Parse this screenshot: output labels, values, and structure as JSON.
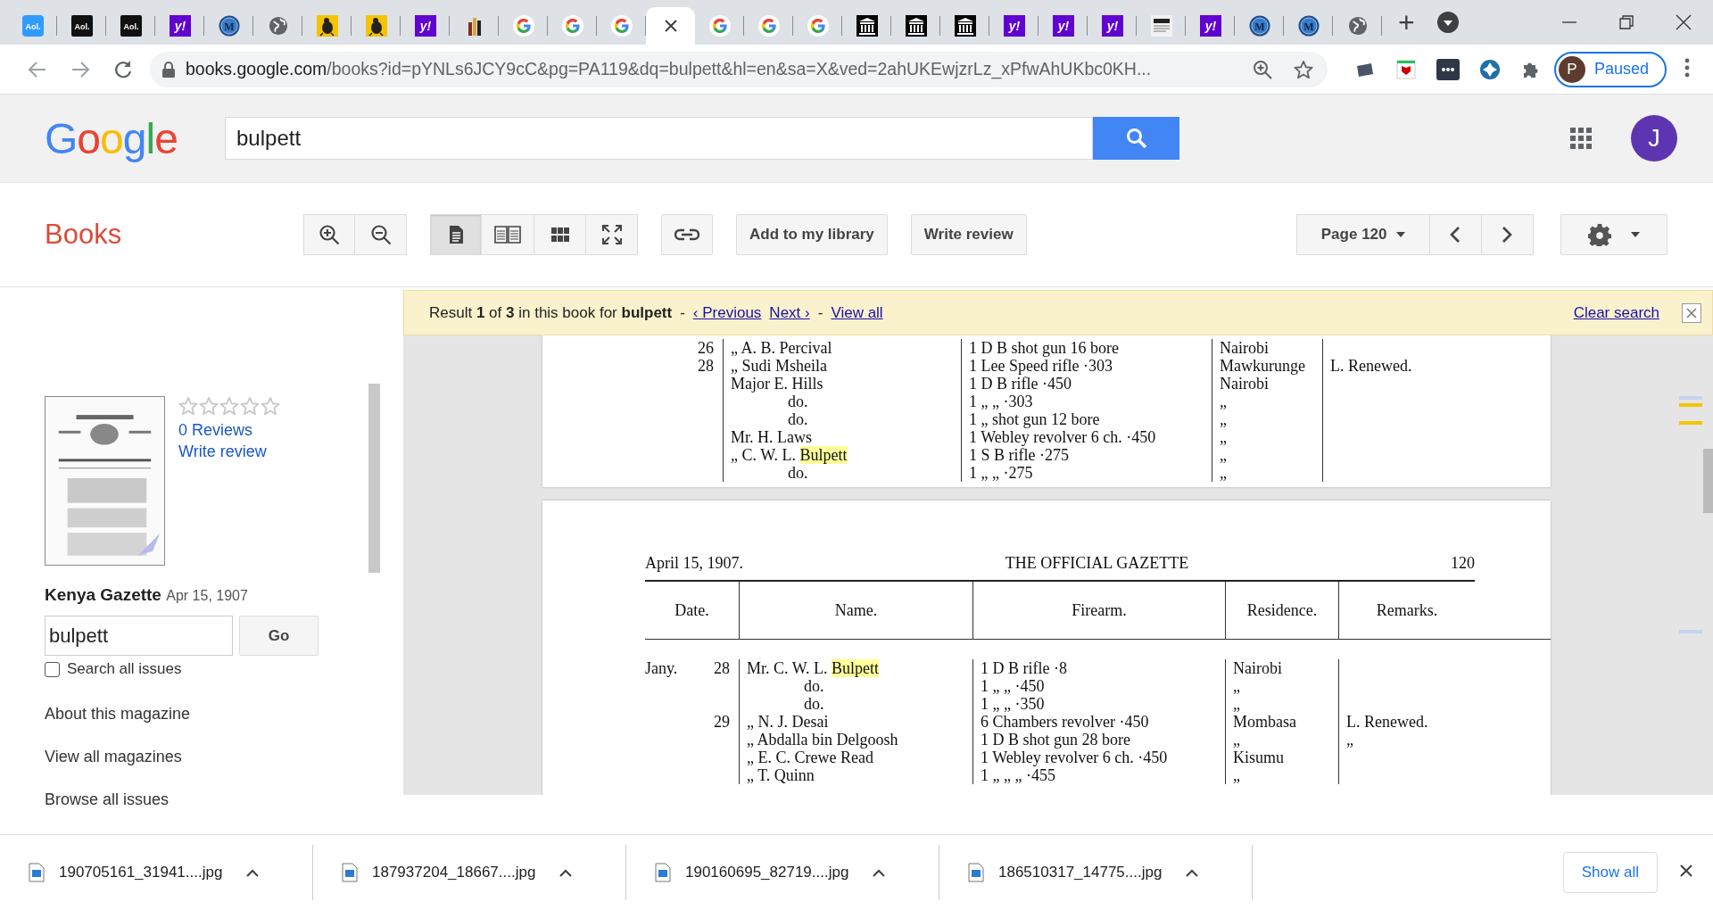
{
  "browser": {
    "tabs": [
      {
        "kind": "aol-blue",
        "text": "Aol.",
        "selected": false
      },
      {
        "kind": "aol-black",
        "text": "Aol.",
        "selected": false
      },
      {
        "kind": "aol-black",
        "text": "Aol.",
        "selected": false
      },
      {
        "kind": "yahoo",
        "text": "y!",
        "selected": false
      },
      {
        "kind": "m",
        "text": "M",
        "selected": false
      },
      {
        "kind": "globe",
        "selected": false
      },
      {
        "kind": "bird",
        "selected": false
      },
      {
        "kind": "bird",
        "selected": false
      },
      {
        "kind": "yahoo",
        "text": "y!",
        "selected": false
      },
      {
        "kind": "tower",
        "selected": false
      },
      {
        "kind": "google",
        "selected": false
      },
      {
        "kind": "google",
        "selected": false
      },
      {
        "kind": "google",
        "selected": false
      },
      {
        "kind": "none",
        "selected": true
      },
      {
        "kind": "google",
        "selected": false
      },
      {
        "kind": "google",
        "selected": false
      },
      {
        "kind": "google",
        "selected": false
      },
      {
        "kind": "columns",
        "selected": false
      },
      {
        "kind": "columns",
        "selected": false
      },
      {
        "kind": "columns",
        "selected": false
      },
      {
        "kind": "yahoo",
        "text": "y!",
        "selected": false
      },
      {
        "kind": "yahoo",
        "text": "y!",
        "selected": false
      },
      {
        "kind": "yahoo",
        "text": "y!",
        "selected": false
      },
      {
        "kind": "newspaper",
        "selected": false
      },
      {
        "kind": "yahoo",
        "text": "y!",
        "selected": false
      },
      {
        "kind": "m",
        "text": "M",
        "selected": false
      },
      {
        "kind": "m",
        "text": "M",
        "selected": false
      },
      {
        "kind": "globe",
        "selected": false
      }
    ],
    "new_tab": "+",
    "address": {
      "host": "books.google.com",
      "path": "/books?id=pYNLs6JCY9cC&pg=PA119&dq=bulpett&hl=en&sa=X&ved=2ahUKEwjzrLz_xPfwAhUKbc0KH..."
    },
    "profile": {
      "initial": "P",
      "label": "Paused"
    }
  },
  "header": {
    "logo": "Google",
    "query": "bulpett",
    "avatar": "J"
  },
  "toolbar": {
    "section": "Books",
    "view_modes": [
      {
        "kind": "single",
        "selected": true
      },
      {
        "kind": "double",
        "selected": false
      },
      {
        "kind": "grid",
        "selected": false
      },
      {
        "kind": "fullscreen",
        "selected": false
      }
    ],
    "buttons": [
      "Add to my library",
      "Write review"
    ],
    "page": "Page 120"
  },
  "sidebar": {
    "stars": 0,
    "reviews": "0 Reviews",
    "write_review": "Write review",
    "title": "Kenya Gazette",
    "date": "Apr 15, 1907",
    "search_value": "bulpett",
    "go": "Go",
    "search_all": {
      "label": "Search all issues",
      "checked": false
    },
    "links": [
      "About this magazine",
      "View all magazines",
      "Browse all issues"
    ]
  },
  "search_result": {
    "summary": "Result **1** of **3** in this book for **bulpett**",
    "sep1": "-",
    "previous": "‹ Previous",
    "next": "Next ›",
    "sep2": "-",
    "view_all": "View all",
    "clear": "Clear search"
  },
  "pages": [
    {
      "rows": [
        {
          "day": "26",
          "name": "„ A. B. Percival",
          "indented": false,
          "firearm": "1 D B shot gun 16 bore",
          "residence": "Nairobi"
        },
        {
          "day": "28",
          "name": "„ Sudi Msheila",
          "indented": false,
          "firearm": "1 Lee Speed rifle ·303",
          "residence": "Mawkurunge",
          "remarks": "L. Renewed."
        },
        {
          "name": "Major E. Hills",
          "indented": false,
          "firearm": "1 D B rifle ·450",
          "residence": "Nairobi"
        },
        {
          "name": "do.",
          "indented": true,
          "firearm": "1 „ „ ·303",
          "residence": "„"
        },
        {
          "name": "do.",
          "indented": true,
          "firearm": "1 „ shot gun 12 bore",
          "residence": "„"
        },
        {
          "name": "Mr. H. Laws",
          "indented": false,
          "firearm": "1 Webley revolver 6 ch. ·450",
          "residence": "„"
        },
        {
          "name": "„ C. W. L.",
          "match": "Bulpett",
          "indented": false,
          "firearm": "1 S B rifle ·275",
          "residence": "„"
        },
        {
          "name": "do.",
          "indented": true,
          "firearm": "1 „ „ ·275",
          "residence": "„"
        }
      ]
    },
    {
      "heading": {
        "date": "April 15, 1907.",
        "title": "THE OFFICIAL GAZETTE",
        "number": "120"
      },
      "columns": [
        "Date.",
        "Name.",
        "Firearm.",
        "Residence.",
        "Remarks."
      ],
      "rows": [
        {
          "month": "Jany.",
          "day": "28",
          "name": "Mr. C. W. L.",
          "match": "Bulpett",
          "indented": false,
          "firearm": "1 D B rifle ·8",
          "residence": "Nairobi"
        },
        {
          "name": "do.",
          "indented": true,
          "firearm": "1 „ „ ·450",
          "residence": "„"
        },
        {
          "name": "do.",
          "indented": true,
          "firearm": "1 „ „ ·350",
          "residence": "„"
        },
        {
          "day": "29",
          "name": "„ N. J. Desai",
          "indented": false,
          "firearm": "6 Chambers revolver ·450",
          "residence": "Mombasa",
          "remarks": "L. Renewed."
        },
        {
          "name": "„ Abdalla bin Delgoosh",
          "indented": false,
          "firearm": "1 D B shot gun 28 bore",
          "residence": "„",
          "remarks": "„"
        },
        {
          "name": "„ E. C. Crewe Read",
          "indented": false,
          "firearm": "1 Webley revolver 6 ch. ·450",
          "residence": "Kisumu"
        },
        {
          "name": "„ T. Quinn",
          "indented": false,
          "firearm": "1 „ „ „ ·455",
          "residence": "„"
        }
      ]
    }
  ],
  "downloads": {
    "files": [
      "190705161_31941....jpg",
      "187937204_18667....jpg",
      "190160695_82719....jpg",
      "186510317_14775....jpg"
    ],
    "show_all": "Show all"
  }
}
